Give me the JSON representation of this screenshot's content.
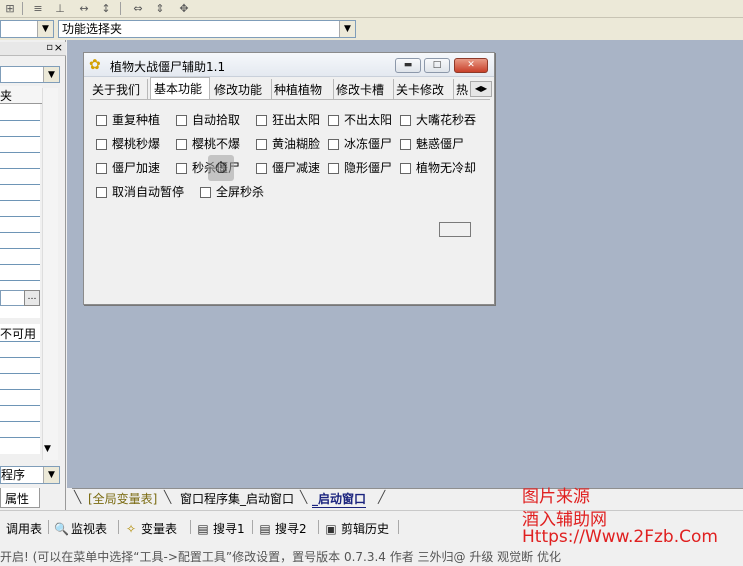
{
  "combo": {
    "selected": "功能选择夹"
  },
  "left_panel": {
    "header_frag": "夹",
    "combo_frag": "不可用",
    "bottom_combo": "程序",
    "tab": "属性"
  },
  "dialog": {
    "title": "植物大战僵尸辅助1.1",
    "buttons": [
      "minimize-icon",
      "maximize-icon",
      "close-icon"
    ],
    "tabs": [
      "关于我们",
      "基本功能",
      "修改功能",
      "种植植物",
      "修改卡槽",
      "关卡修改",
      "热"
    ],
    "active_tab": "基本功能",
    "checkboxes": [
      [
        "重复种植",
        "自动拾取",
        "狂出太阳",
        "不出太阳",
        "大嘴花秒吞"
      ],
      [
        "樱桃秒爆",
        "樱桃不爆",
        "黄油糊脸",
        "冰冻僵尸",
        "魅惑僵尸"
      ],
      [
        "僵尸加速",
        "秒杀僵尸",
        "僵尸减速",
        "隐形僵尸",
        "植物无冷却"
      ],
      [
        "取消自动暂停",
        "全屏秒杀"
      ]
    ],
    "cursor": "stopwatch-cursor-icon"
  },
  "bottom_tabs": [
    "[全局变量表]",
    "窗口程序集_启动窗口",
    "_启动窗口"
  ],
  "bar2": [
    "调用表",
    "监视表",
    "变量表",
    "搜寻1",
    "搜寻2",
    "剪辑历史"
  ],
  "status": "开启! (可以在菜单中选择“工具->配置工具”修改设置，置号版本 0.7.3.4 作者 三外归@ 升级 观觉断 优化",
  "watermark": [
    "图片来源",
    "酒入辅助网",
    "Https://Www.2Fzb.Com"
  ],
  "colors": {
    "workspace": "#a9b4c6",
    "watermark": "#e02020",
    "active_bottom_tab": "#1a237e"
  }
}
